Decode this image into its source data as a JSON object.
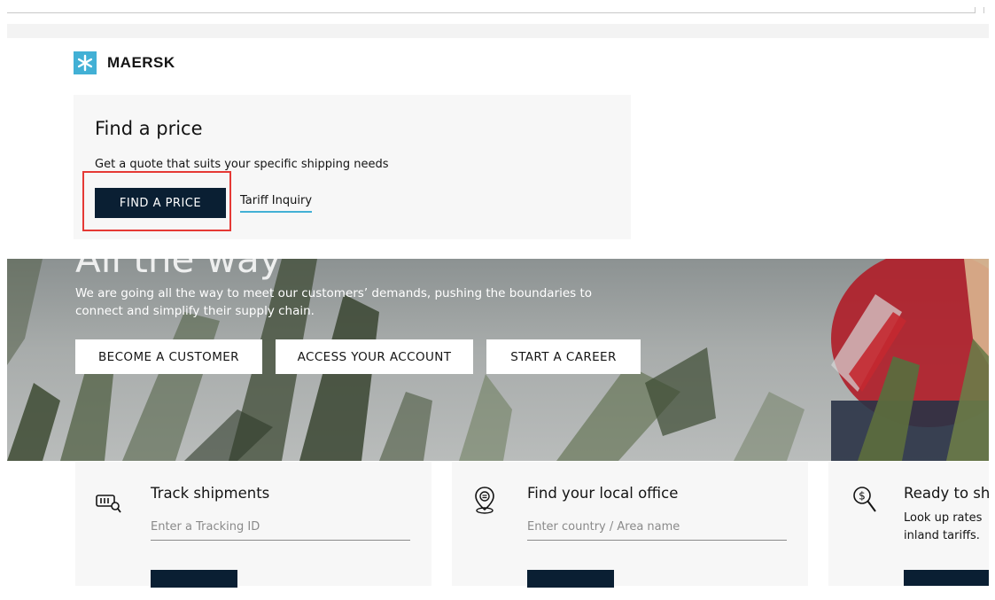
{
  "brand": {
    "name": "MAERSK",
    "logo_icon": "star-icon",
    "accent_color": "#42b0d5",
    "dark_color": "#0a1f33"
  },
  "price_card": {
    "title": "Find a price",
    "subtitle": "Get a quote that suits your specific shipping needs",
    "button_label": "FIND A PRICE",
    "link_label": "Tariff Inquiry"
  },
  "hero": {
    "heading": "All the way",
    "text": "We are going all the way to meet our customers’ demands, pushing the boundaries to connect and simplify their supply chain.",
    "buttons": [
      {
        "label": "BECOME A CUSTOMER"
      },
      {
        "label": "ACCESS YOUR ACCOUNT"
      },
      {
        "label": "START A CAREER"
      }
    ]
  },
  "cards": [
    {
      "icon": "barcode-search-icon",
      "title": "Track shipments",
      "placeholder": "Enter a Tracking ID",
      "value": ""
    },
    {
      "icon": "location-pin-icon",
      "title": "Find your local office",
      "placeholder": "Enter country / Area name",
      "value": ""
    },
    {
      "icon": "dollar-search-icon",
      "title": "Ready to sh",
      "lines": [
        "Look up rates",
        "inland tariffs."
      ]
    }
  ]
}
